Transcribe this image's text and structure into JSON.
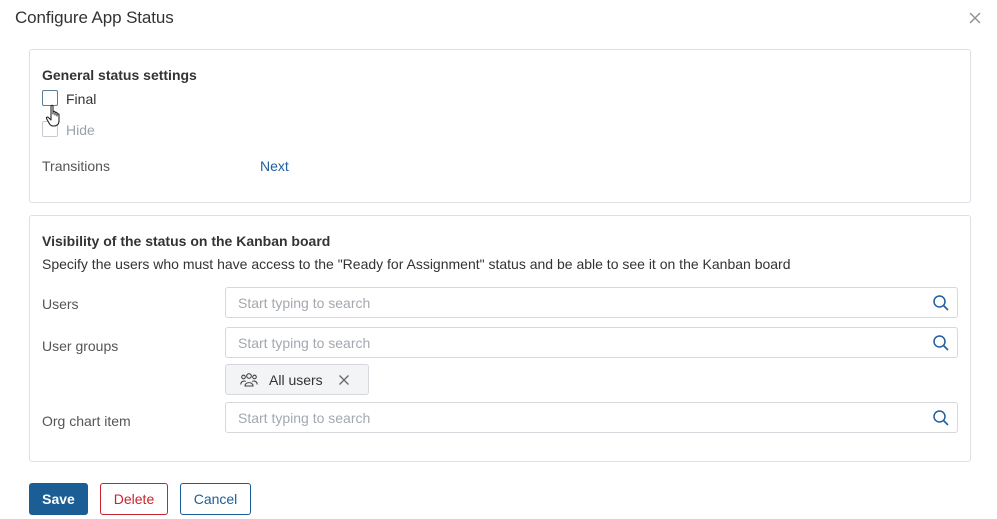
{
  "dialog": {
    "title": "Configure App Status"
  },
  "general": {
    "heading": "General status settings",
    "final_label": "Final",
    "hide_label": "Hide",
    "transitions_label": "Transitions",
    "transitions_link": "Next"
  },
  "visibility": {
    "heading": "Visibility of the status on the Kanban board",
    "description": "Specify the users who must have access to the \"Ready for Assignment\" status and be able to see it on the Kanban board",
    "users_label": "Users",
    "users_placeholder": "Start typing to search",
    "groups_label": "User groups",
    "groups_placeholder": "Start typing to search",
    "groups_selected": [
      "All users"
    ],
    "org_label": "Org chart item",
    "org_placeholder": "Start typing to search"
  },
  "footer": {
    "save_label": "Save",
    "delete_label": "Delete",
    "cancel_label": "Cancel"
  },
  "colors": {
    "primary": "#1b5e95",
    "danger": "#c9242b",
    "link": "#1f5fa0"
  },
  "icons": [
    "close-icon",
    "cursor-hand-icon",
    "search-icon",
    "user-group-icon",
    "remove-icon"
  ]
}
